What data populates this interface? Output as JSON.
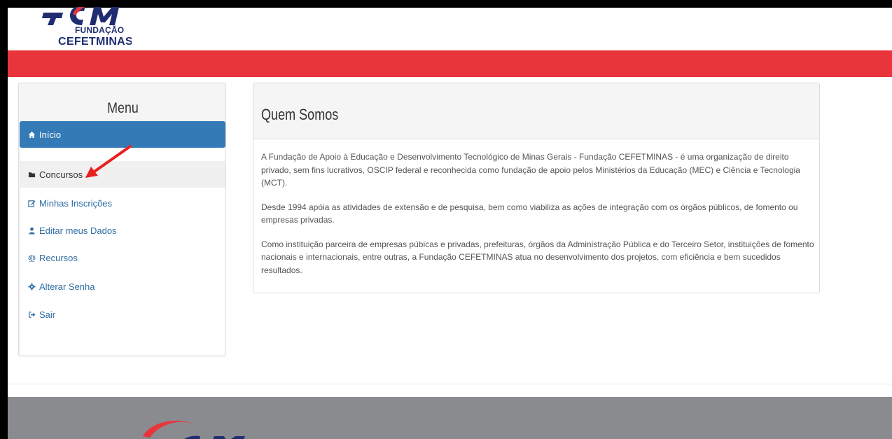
{
  "header": {
    "logo": {
      "line1": "FUNDAÇÃO",
      "line2": "CEFETMINAS",
      "accent_color": "#e8353b",
      "brand_color": "#1f2d70"
    },
    "bar_color": "#e8353b"
  },
  "sidebar": {
    "title": "Menu",
    "items": [
      {
        "label": "Início",
        "icon": "home-icon",
        "state": "active"
      },
      {
        "label": "Concursos",
        "icon": "folder-icon",
        "state": "hover"
      },
      {
        "label": "Minhas Inscrições",
        "icon": "edit-icon",
        "state": "normal"
      },
      {
        "label": "Editar meus Dados",
        "icon": "user-icon",
        "state": "normal"
      },
      {
        "label": "Recursos",
        "icon": "balance-scale-icon",
        "state": "normal"
      },
      {
        "label": "Alterar Senha",
        "icon": "gear-icon",
        "state": "normal"
      },
      {
        "label": "Sair",
        "icon": "logout-icon",
        "state": "normal"
      }
    ]
  },
  "content": {
    "title": "Quem Somos",
    "paragraphs": [
      "A Fundação de Apoio à Educação e Desenvolvimento Tecnológico de Minas Gerais - Fundação CEFETMINAS - é uma organização de direito privado, sem fins lucrativos, OSCIP federal e reconhecida como fundação de apoio pelos Ministérios da Educação (MEC) e Ciência e Tecnologia (MCT).",
      "Desde 1994 apóia as atividades de extensão e de pesquisa, bem como viabiliza as ações de integração com os órgãos públicos, de fomento ou empresas privadas.",
      "Como instituição parceira de empresas púbicas e privadas, prefeituras, órgãos da Administração Pública e do Terceiro Setor, instituições de fomento nacionais e internacionais, entre outras, a Fundação CEFETMINAS atua no desenvolvimento dos projetos, com eficiência e bem sucedidos resultados."
    ]
  },
  "annotation": {
    "icon": "red-arrow-icon",
    "color": "#e8201f"
  },
  "footer": {
    "background": "#898b8f"
  }
}
